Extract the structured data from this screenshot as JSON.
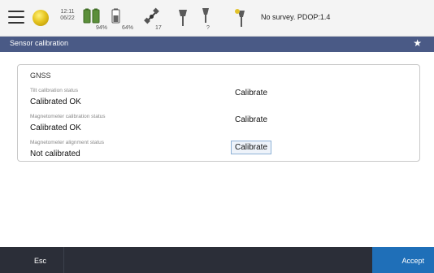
{
  "status_bar": {
    "time": "12:11",
    "date": "06/22",
    "battery_1_percent": "94%",
    "battery_2_percent": "64%",
    "satellites": "17",
    "radio_value": "?",
    "survey_status": "No survey. PDOP:1.4"
  },
  "title_bar": {
    "title": "Sensor calibration"
  },
  "group": {
    "title": "GNSS",
    "rows": [
      {
        "label": "Tilt calibration status",
        "value": "Calibrated OK",
        "button": "Calibrate"
      },
      {
        "label": "Magnetometer calibration status",
        "value": "Calibrated OK",
        "button": "Calibrate"
      },
      {
        "label": "Magnetometer alignment status",
        "value": "Not calibrated",
        "button": "Calibrate"
      }
    ]
  },
  "footer": {
    "esc_label": "Esc",
    "accept_label": "Accept"
  },
  "colors": {
    "title_bar": "#4a5a86",
    "bottom_bar": "#2b2e38",
    "accept": "#1f6fb8"
  }
}
